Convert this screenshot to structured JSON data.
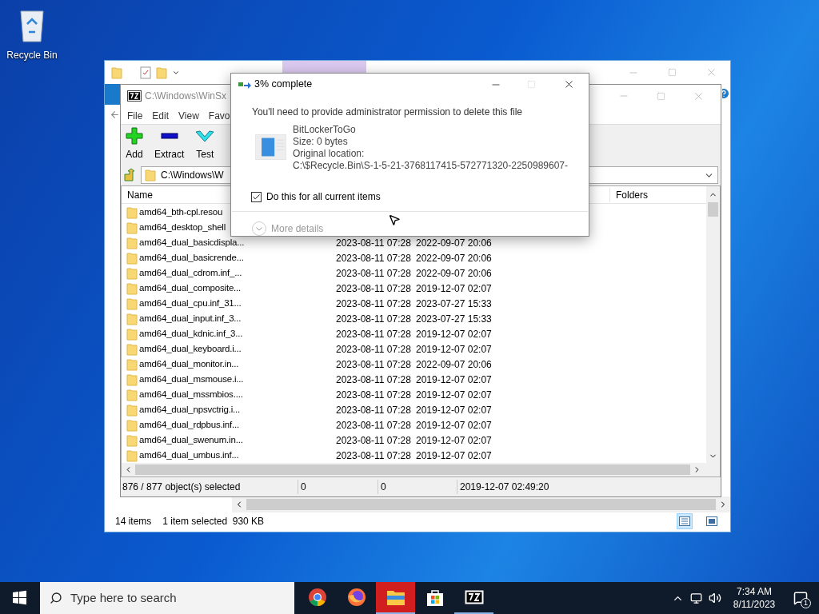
{
  "desktop_icons": [
    {
      "label": "Recycle Bin"
    }
  ],
  "explorer": {
    "status_items": [
      "14 items",
      "1 item selected  930 KB"
    ],
    "views": [
      {
        "kind": "details",
        "selected": true
      },
      {
        "kind": "preview",
        "selected": false
      }
    ]
  },
  "sevenzip": {
    "title": "C:\\Windows\\WinSx",
    "menu": [
      "File",
      "Edit",
      "View",
      "Favo"
    ],
    "toolbar": [
      {
        "kind": "add",
        "label": "Add"
      },
      {
        "kind": "extract",
        "label": "Extract"
      },
      {
        "kind": "test",
        "label": "Test"
      }
    ],
    "address": "C:\\Windows\\W",
    "columns": [
      "Name",
      "Folders"
    ],
    "rows": [
      {
        "name": "amd64_bth-cpl.resou"
      },
      {
        "name": "amd64_desktop_shell"
      },
      {
        "name": "amd64_dual_basicdispla...",
        "column_2": "2023-08-11 07:28",
        "column_3": "2022-09-07 20:06"
      },
      {
        "name": "amd64_dual_basicrende...",
        "column_2": "2023-08-11 07:28",
        "column_3": "2022-09-07 20:06"
      },
      {
        "name": "amd64_dual_cdrom.inf_...",
        "column_2": "2023-08-11 07:28",
        "column_3": "2022-09-07 20:06"
      },
      {
        "name": "amd64_dual_composite...",
        "column_2": "2023-08-11 07:28",
        "column_3": "2019-12-07 02:07"
      },
      {
        "name": "amd64_dual_cpu.inf_31...",
        "column_2": "2023-08-11 07:28",
        "column_3": "2023-07-27 15:33"
      },
      {
        "name": "amd64_dual_input.inf_3...",
        "column_2": "2023-08-11 07:28",
        "column_3": "2023-07-27 15:33"
      },
      {
        "name": "amd64_dual_kdnic.inf_3...",
        "column_2": "2023-08-11 07:28",
        "column_3": "2019-12-07 02:07"
      },
      {
        "name": "amd64_dual_keyboard.i...",
        "column_2": "2023-08-11 07:28",
        "column_3": "2019-12-07 02:07"
      },
      {
        "name": "amd64_dual_monitor.in...",
        "column_2": "2023-08-11 07:28",
        "column_3": "2022-09-07 20:06"
      },
      {
        "name": "amd64_dual_msmouse.i...",
        "column_2": "2023-08-11 07:28",
        "column_3": "2019-12-07 02:07"
      },
      {
        "name": "amd64_dual_mssmbios....",
        "column_2": "2023-08-11 07:28",
        "column_3": "2019-12-07 02:07"
      },
      {
        "name": "amd64_dual_npsvctrig.i...",
        "column_2": "2023-08-11 07:28",
        "column_3": "2019-12-07 02:07"
      },
      {
        "name": "amd64_dual_rdpbus.inf...",
        "column_2": "2023-08-11 07:28",
        "column_3": "2019-12-07 02:07"
      },
      {
        "name": "amd64_dual_swenum.in...",
        "column_2": "2023-08-11 07:28",
        "column_3": "2019-12-07 02:07"
      },
      {
        "name": "amd64_dual_umbus.inf...",
        "column_2": "2023-08-11 07:28",
        "column_3": "2019-12-07 02:07"
      }
    ],
    "status": [
      "876 / 877 object(s) selected",
      "0",
      "0",
      "2019-12-07 02:49:20"
    ]
  },
  "dialog": {
    "title": "3% complete",
    "message": "You'll need to provide administrator permission to delete this file",
    "file": [
      "BitLockerToGo",
      "Size: 0 bytes",
      "Original location:",
      "C:\\$Recycle.Bin\\S-1-5-21-3768117415-572771320-2250989607-"
    ],
    "checkbox": {
      "label": "Do this for all current items",
      "checked": true
    },
    "more_details": {
      "label": "More details",
      "disabled": true
    }
  },
  "taskbar": {
    "search_placeholder": "Type here to search",
    "apps": [
      {
        "kind": "chrome",
        "running": false,
        "flashing": false
      },
      {
        "kind": "firefox",
        "running": false,
        "flashing": false
      },
      {
        "kind": "explorer",
        "running": true,
        "flashing": true
      },
      {
        "kind": "store",
        "running": false,
        "flashing": false
      },
      {
        "kind": "sevenzip",
        "running": true,
        "flashing": false
      }
    ],
    "time": "7:34 AM",
    "date": "8/11/2023",
    "notifications": "1"
  }
}
